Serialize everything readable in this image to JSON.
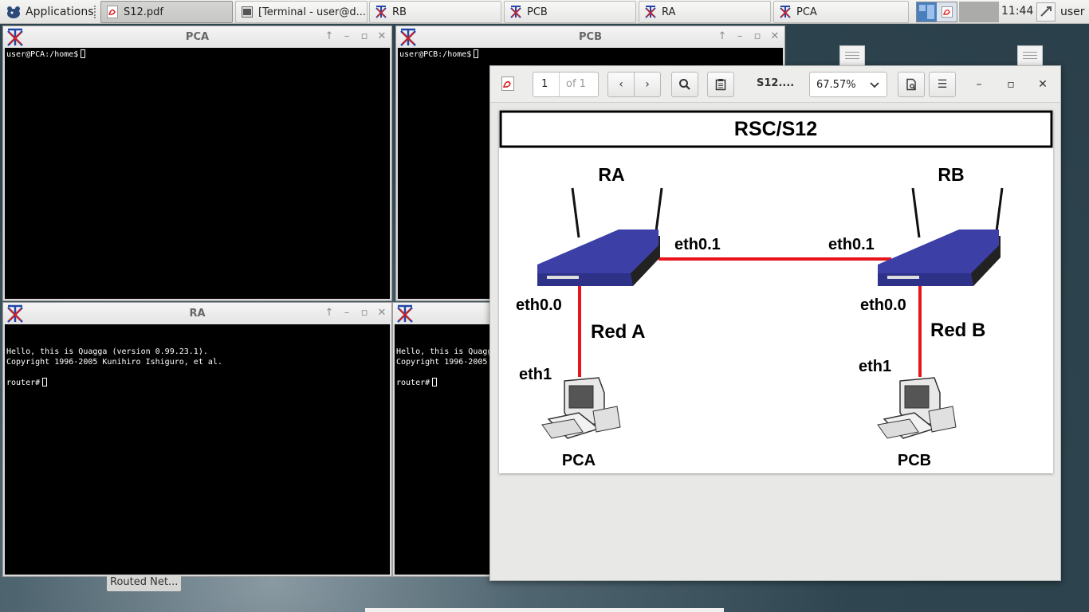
{
  "taskbar": {
    "apps_label": "Applications",
    "tasks": [
      {
        "label": "S12.pdf",
        "icon": "pdf-icon"
      },
      {
        "label": "[Terminal - user@d...",
        "icon": "terminal-icon"
      },
      {
        "label": "RB",
        "icon": "x-icon"
      },
      {
        "label": "PCB",
        "icon": "x-icon"
      },
      {
        "label": "RA",
        "icon": "x-icon"
      },
      {
        "label": "PCA",
        "icon": "x-icon"
      }
    ],
    "clock": "11:44",
    "user": "user"
  },
  "windows": {
    "pca": {
      "title": "PCA",
      "content": "user@PCA:/home$"
    },
    "pcb": {
      "title": "PCB",
      "content": "user@PCB:/home$"
    },
    "ra": {
      "title": "RA",
      "line1": "Hello, this is Quagga (version 0.99.23.1).",
      "line2": "Copyright 1996-2005 Kunihiro Ishiguro, et al.",
      "prompt": "router#"
    },
    "rb": {
      "line1": "Hello, this is Quagg",
      "line2": "Copyright 1996-2005",
      "prompt": "router#"
    }
  },
  "pdf_viewer": {
    "page_number": "1",
    "page_of": "of 1",
    "doc_title": "S12....",
    "zoom": "67.57%",
    "diagram": {
      "title": "RSC/S12",
      "router_a": "RA",
      "router_b": "RB",
      "eth01_a": "eth0.1",
      "eth01_b": "eth0.1",
      "eth00_a": "eth0.0",
      "eth00_b": "eth0.0",
      "net_a": "Red A",
      "net_b": "Red B",
      "eth1_a": "eth1",
      "eth1_b": "eth1",
      "pc_a": "PCA",
      "pc_b": "PCB",
      "link_color": "#e8141c",
      "router_color": "#3b3fa6"
    }
  },
  "desktop": {
    "label": "Routed Net..."
  }
}
